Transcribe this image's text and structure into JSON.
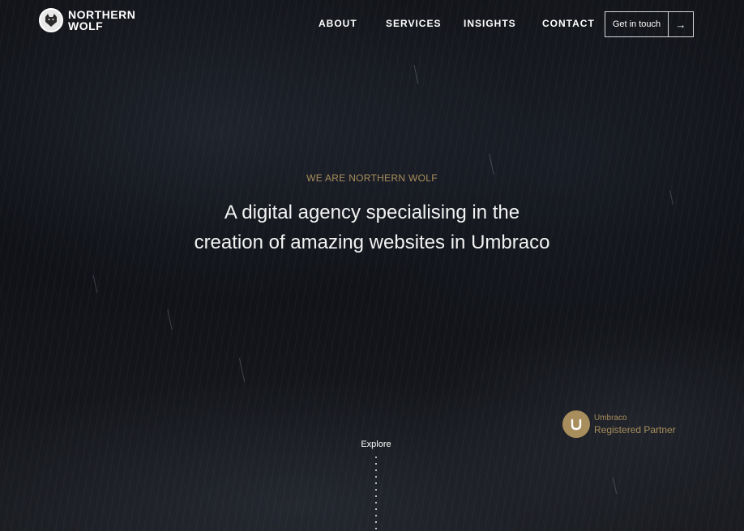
{
  "brand": {
    "name_line1": "NORTHERN",
    "name_line2": "WOLF",
    "logo_icon": "wolf-head-icon"
  },
  "nav": {
    "items": [
      "ABOUT",
      "SERVICES",
      "INSIGHTS",
      "CONTACT"
    ],
    "cta_label": "Get in touch",
    "cta_icon": "arrow-right-icon"
  },
  "hero": {
    "eyebrow": "WE ARE NORTHERN WOLF",
    "headline": "A digital agency specialising in the creation of amazing websites in Umbraco"
  },
  "partner": {
    "icon": "umbraco-icon",
    "line1": "Umbraco",
    "line2": "Registered Partner"
  },
  "explore": {
    "label": "Explore"
  },
  "colors": {
    "accent": "#a88e5c",
    "background": "#121419",
    "text": "#ffffff"
  }
}
